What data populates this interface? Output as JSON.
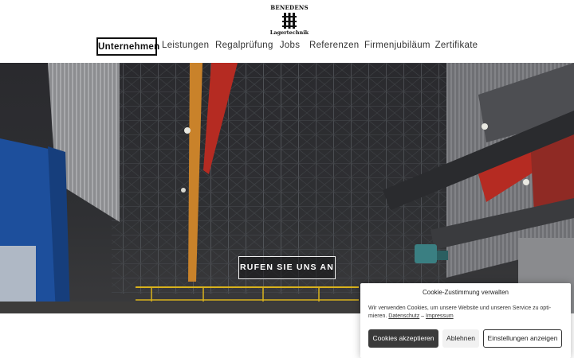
{
  "logo": {
    "top_text": "BENEDENS",
    "bottom_text": "Lagertechnik"
  },
  "nav": {
    "items": [
      {
        "label": "Unternehmen",
        "active": true
      },
      {
        "label": "Leistungen",
        "active": false
      },
      {
        "label": "Regalprüfung",
        "active": false
      },
      {
        "label": "Jobs",
        "active": false
      },
      {
        "label": "Referenzen",
        "active": false
      },
      {
        "label": "Firmenjubiläum",
        "active": false
      },
      {
        "label": "Zertifikate",
        "active": false
      }
    ]
  },
  "hero": {
    "cta_label": "RUFEN SIE UNS AN"
  },
  "cookie_banner": {
    "title": "Cookie-Zustimmung verwalten",
    "text": "Wir verwenden Cookies, um unsere Website und unseren Service zu opti-mieren.",
    "link_privacy": "Datenschutz",
    "separator": "–",
    "link_imprint": "Impressum",
    "accept_label": "Cookies akzeptieren",
    "deny_label": "Ablehnen",
    "settings_label": "Einstellungen anzeigen"
  },
  "colors": {
    "accent_dark": "#3a3a3a",
    "hero_dark": "#1f1f22",
    "beam_orange": "#c9822a",
    "beam_red": "#b52b22",
    "column_blue": "#1d4f9c"
  }
}
